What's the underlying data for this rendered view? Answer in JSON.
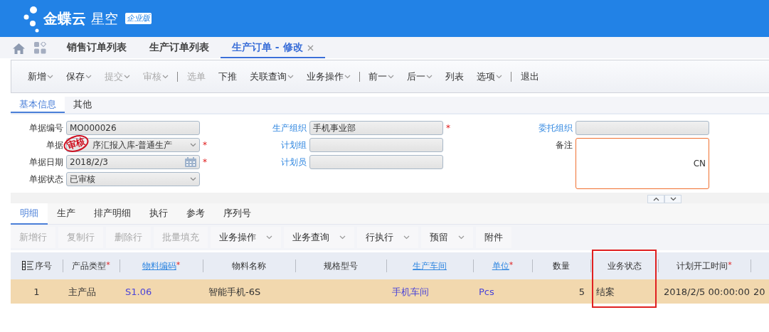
{
  "brand": {
    "name": "金蝶云",
    "product": "星空",
    "edition": "企业版"
  },
  "tabs": [
    {
      "label": "销售订单列表",
      "selected": false,
      "closable": false
    },
    {
      "label": "生产订单列表",
      "selected": false,
      "closable": false
    },
    {
      "label": "生产订单 - 修改",
      "selected": true,
      "closable": true
    }
  ],
  "toolbar": [
    {
      "kind": "button",
      "label": "新增",
      "dropdown": true,
      "disabled": false
    },
    {
      "kind": "button",
      "label": "保存",
      "dropdown": true,
      "disabled": false
    },
    {
      "kind": "button",
      "label": "提交",
      "dropdown": true,
      "disabled": true
    },
    {
      "kind": "button",
      "label": "审核",
      "dropdown": true,
      "disabled": true
    },
    {
      "kind": "separator"
    },
    {
      "kind": "button",
      "label": "选单",
      "dropdown": false,
      "disabled": true
    },
    {
      "kind": "button",
      "label": "下推",
      "dropdown": false,
      "disabled": false
    },
    {
      "kind": "button",
      "label": "关联查询",
      "dropdown": true,
      "disabled": false
    },
    {
      "kind": "button",
      "label": "业务操作",
      "dropdown": true,
      "disabled": false
    },
    {
      "kind": "separator"
    },
    {
      "kind": "button",
      "label": "前一",
      "dropdown": true,
      "disabled": false
    },
    {
      "kind": "button",
      "label": "后一",
      "dropdown": true,
      "disabled": false
    },
    {
      "kind": "button",
      "label": "列表",
      "dropdown": false,
      "disabled": false
    },
    {
      "kind": "button",
      "label": "选项",
      "dropdown": true,
      "disabled": false
    },
    {
      "kind": "separator"
    },
    {
      "kind": "button",
      "label": "退出",
      "dropdown": false,
      "disabled": false
    }
  ],
  "form_tabs": [
    {
      "label": "基本信息",
      "selected": true
    },
    {
      "label": "其他",
      "selected": false
    }
  ],
  "form_columns": [
    [
      {
        "label": "单据编号",
        "link": false,
        "kind": "text",
        "value": "MO000026"
      },
      {
        "label": "单据",
        "link": false,
        "kind": "select",
        "value": "序汇报入库-普通生产",
        "required_mark": "*",
        "stamp": "审核"
      },
      {
        "label": "单据日期",
        "link": false,
        "kind": "date",
        "value": "2018/2/3",
        "required_mark": "*"
      },
      {
        "label": "单据状态",
        "link": false,
        "kind": "select",
        "value": "已审核"
      }
    ],
    [
      {
        "label": "生产组织",
        "link": true,
        "kind": "text",
        "value": "手机事业部",
        "required_mark": "*"
      },
      {
        "label": "计划组",
        "link": true,
        "kind": "text"
      },
      {
        "label": "计划员",
        "link": true,
        "kind": "text"
      }
    ],
    [
      {
        "label": "委托组织",
        "link": true,
        "kind": "text"
      },
      {
        "label": "备注",
        "link": false,
        "kind": "textarea",
        "value": "CN"
      }
    ]
  ],
  "detail_tabs": [
    {
      "label": "明细",
      "selected": true
    },
    {
      "label": "生产",
      "selected": false
    },
    {
      "label": "排产明细",
      "selected": false
    },
    {
      "label": "执行",
      "selected": false
    },
    {
      "label": "参考",
      "selected": false
    },
    {
      "label": "序列号",
      "selected": false
    }
  ],
  "detail_toolbar": [
    {
      "label": "新增行",
      "dropdown": false,
      "disabled": true
    },
    {
      "label": "复制行",
      "dropdown": false,
      "disabled": true
    },
    {
      "label": "删除行",
      "dropdown": false,
      "disabled": true
    },
    {
      "label": "批量填充",
      "dropdown": false,
      "disabled": true
    },
    {
      "label": "业务操作",
      "dropdown": true,
      "disabled": false
    },
    {
      "label": "业务查询",
      "dropdown": true,
      "disabled": false
    },
    {
      "label": "行执行",
      "dropdown": true,
      "disabled": false
    },
    {
      "label": "预留",
      "dropdown": true,
      "disabled": false
    },
    {
      "label": "附件",
      "dropdown": false,
      "disabled": false
    }
  ],
  "table": {
    "columns": [
      {
        "label": "序号",
        "link": false,
        "highlighted": false
      },
      {
        "label": "产品类型",
        "link": false,
        "required_mark": "*",
        "highlighted": false
      },
      {
        "label": "物料编码",
        "link": true,
        "required_mark": "*",
        "highlighted": false
      },
      {
        "label": "物料名称",
        "link": false,
        "highlighted": false
      },
      {
        "label": "规格型号",
        "link": false,
        "highlighted": false
      },
      {
        "label": "生产车间",
        "link": true,
        "highlighted": false
      },
      {
        "label": "单位",
        "link": true,
        "required_mark": "*",
        "highlighted": false
      },
      {
        "label": "数量",
        "link": false,
        "highlighted": false
      },
      {
        "label": "业务状态",
        "link": false,
        "highlighted": true
      },
      {
        "label": "计划开工时间",
        "link": false,
        "required_mark": "*",
        "highlighted": false
      },
      {
        "highlighted": false
      }
    ],
    "rows": [
      {
        "selected": true,
        "cells": [
          {
            "text": "1",
            "link": false
          },
          {
            "text": "主产品",
            "link": false
          },
          {
            "text": "S1.06",
            "link": true
          },
          {
            "text": "智能手机-6S",
            "link": false
          },
          {},
          {
            "text": "手机车间",
            "link": true
          },
          {
            "text": "Pcs",
            "link": true
          },
          {
            "text": "5",
            "link": false
          },
          {
            "text": "结案",
            "link": false
          },
          {
            "text": "2018/2/5 00:00:00",
            "link": false
          },
          {
            "text": "20",
            "link": false
          }
        ]
      }
    ]
  }
}
